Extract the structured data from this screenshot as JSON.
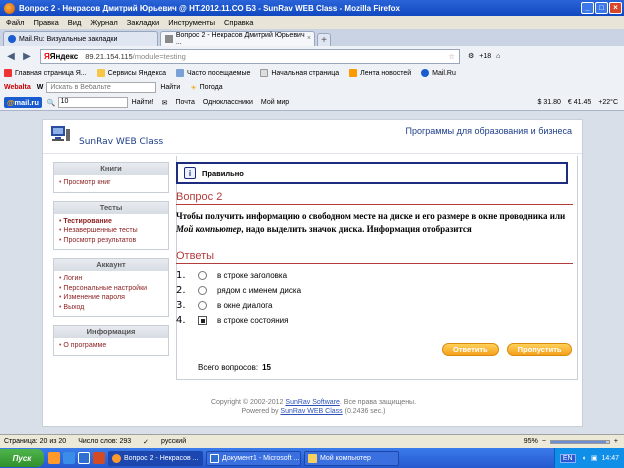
{
  "window": {
    "title": "Вопрос 2 - Некрасов Дмитрий Юрьевич @ НТ.2012.11.СО Б3 - SunRav WEB Class - Mozilla Firefox"
  },
  "menu": [
    "Файл",
    "Правка",
    "Вид",
    "Журнал",
    "Закладки",
    "Инструменты",
    "Справка"
  ],
  "tabs": [
    {
      "label": "Mail.Ru: Визуальные закладки"
    },
    {
      "label": "Вопрос 2 - Некрасов Дмитрий Юрьевич ..."
    }
  ],
  "nav": {
    "search_engine": "Яндекс",
    "url_host": "89.21.154.115",
    "url_path": "/module=testing",
    "counter": "+18"
  },
  "bookmarks": [
    "Главная страница Я...",
    "Сервисы Яндекса",
    "Часто посещаемые",
    "Начальная страница",
    "Лента новостей",
    "Mail.Ru"
  ],
  "toolbar1": {
    "brand": "Webalta",
    "search_placeholder": "Искать в Вебальте",
    "find_label": "Найти",
    "weather_label": "Погода"
  },
  "toolbar2": {
    "brand": "@mail.ru",
    "search_value": "10",
    "find_label": "Найти!",
    "mail_label": "Почта",
    "ok_label": "Одноклассники",
    "myworld_label": "Мой мир",
    "usd": "31.80",
    "eur": "41.45",
    "temp": "+22°C"
  },
  "site": {
    "logo_text": "SunRav WEB Class",
    "tagline": "Программы для образования и бизнеса"
  },
  "sidebar": [
    {
      "title": "Книги",
      "items": [
        {
          "label": "Просмотр книг",
          "bold": false
        }
      ]
    },
    {
      "title": "Тесты",
      "items": [
        {
          "label": "Тестирование",
          "bold": true
        },
        {
          "label": "Незавершенные тесты",
          "bold": false
        },
        {
          "label": "Просмотр результатов",
          "bold": false
        }
      ]
    },
    {
      "title": "Аккаунт",
      "items": [
        {
          "label": "Логин",
          "bold": false
        },
        {
          "label": "Персональные настройки",
          "bold": false
        },
        {
          "label": "Изменение пароля",
          "bold": false
        },
        {
          "label": "Выход",
          "bold": false
        }
      ]
    },
    {
      "title": "Информация",
      "items": [
        {
          "label": "О программе",
          "bold": false
        }
      ]
    }
  ],
  "quiz": {
    "notice": "Правильно",
    "question_title": "Вопрос 2",
    "question_text_1": "Чтобы получить информацию о свободном месте на диске и его размере в окне проводника или ",
    "question_text_italic": "Мой компьютер",
    "question_text_2": ", надо выделить значок диска. Информация отобразится",
    "answers_title": "Ответы",
    "answers": [
      {
        "num": "1.",
        "text": "в строке заголовка",
        "type": "radio"
      },
      {
        "num": "2.",
        "text": "рядом с именем диска",
        "type": "radio"
      },
      {
        "num": "3.",
        "text": "в окне диалога",
        "type": "radio"
      },
      {
        "num": "4.",
        "text": "в строке состояния",
        "type": "checked"
      }
    ],
    "answer_button": "Ответить",
    "skip_button": "Пропустить",
    "total_label": "Всего вопросов:",
    "total_value": "15"
  },
  "footer": {
    "copyright_prefix": "Copyright © 2002-2012",
    "copyright_link": "SunRav Software",
    "copyright_suffix": ". Все права защищены.",
    "powered_prefix": "Powered by",
    "powered_link": "SunRav WEB Class",
    "powered_suffix": "(0.2436 sec.)"
  },
  "status": {
    "page": "Страница: 20 из 20",
    "words": "Число слов: 293",
    "lang": "русский",
    "zoom": "95%",
    "zoom_value": 0.95
  },
  "taskbar": {
    "start": "Пуск",
    "tasks": [
      "Вопрос 2 - Некрасов ...",
      "Документ1 - Microsoft ...",
      "Мой компьютер"
    ],
    "lang": "EN",
    "time": "14:47"
  },
  "colors": {
    "accent": "#1d3e8a",
    "link": "#8b1e1e",
    "heading": "#b33c3c",
    "button": "#f5a11b"
  }
}
